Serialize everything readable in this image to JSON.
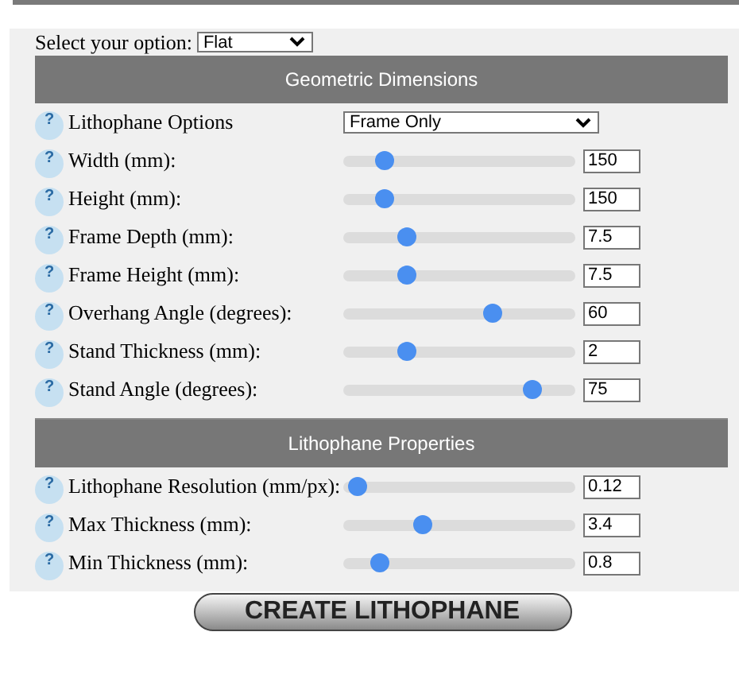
{
  "option_select": {
    "label": "Select your option:",
    "value": "Flat"
  },
  "sections": [
    {
      "title": "Geometric Dimensions",
      "rows": [
        {
          "kind": "select",
          "help": "?",
          "label": "Lithophane Options",
          "value": "Frame Only"
        },
        {
          "kind": "slider",
          "help": "?",
          "label": "Width (mm):",
          "level": 0.15,
          "value": "150"
        },
        {
          "kind": "slider",
          "help": "?",
          "label": "Height (mm):",
          "level": 0.15,
          "value": "150"
        },
        {
          "kind": "slider",
          "help": "?",
          "label": "Frame Depth (mm):",
          "level": 0.25,
          "value": "7.5"
        },
        {
          "kind": "slider",
          "help": "?",
          "label": "Frame Height (mm):",
          "level": 0.25,
          "value": "7.5"
        },
        {
          "kind": "slider",
          "help": "?",
          "label": "Overhang Angle (degrees):",
          "level": 0.66,
          "value": "60"
        },
        {
          "kind": "slider",
          "help": "?",
          "label": "Stand Thickness (mm):",
          "level": 0.25,
          "value": "2"
        },
        {
          "kind": "slider",
          "help": "?",
          "label": "Stand Angle (degrees):",
          "level": 0.84,
          "value": "75"
        }
      ]
    },
    {
      "title": "Lithophane Properties",
      "rows": [
        {
          "kind": "slider",
          "help": "?",
          "label": "Lithophane Resolution (mm/px):",
          "level": 0.02,
          "value": "0.12"
        },
        {
          "kind": "slider",
          "help": "?",
          "label": "Max Thickness (mm):",
          "level": 0.33,
          "value": "3.4"
        },
        {
          "kind": "slider",
          "help": "?",
          "label": "Min Thickness (mm):",
          "level": 0.13,
          "value": "0.8"
        }
      ]
    }
  ],
  "create_button": "CREATE LITHOPHANE"
}
